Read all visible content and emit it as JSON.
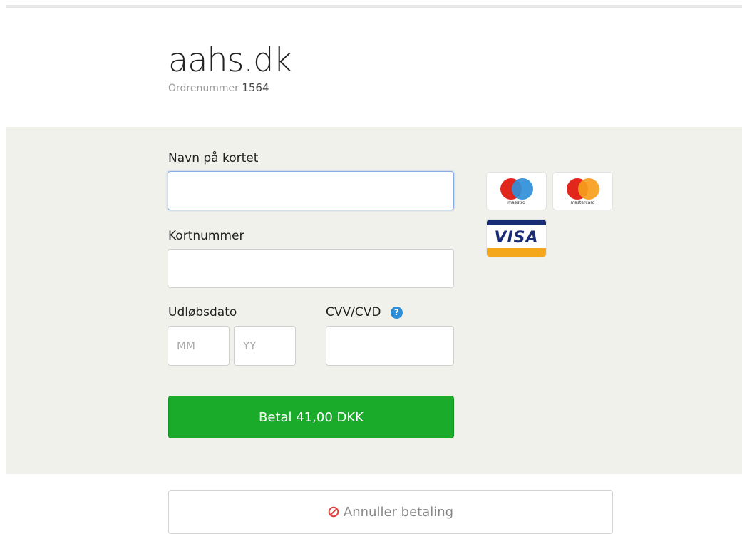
{
  "merchant": {
    "name": "aahs.dk",
    "order_label": "Ordrenummer",
    "order_number": "1564"
  },
  "form": {
    "cardholder_label": "Navn på kortet",
    "cardholder_value": "",
    "cardnumber_label": "Kortnummer",
    "cardnumber_value": "",
    "expiry_label": "Udløbsdato",
    "expiry_month_placeholder": "MM",
    "expiry_year_placeholder": "YY",
    "cvv_label": "CVV/CVD",
    "cvv_help_icon": "question-circle-icon",
    "cvv_value": "",
    "pay_button": "Betal 41,00 DKK"
  },
  "cards": {
    "maestro_label": "maestro",
    "mastercard_label": "mastercard",
    "visa_label": "VISA"
  },
  "cancel": {
    "label": "Annuller betaling",
    "icon": "cancel-circle-icon"
  },
  "colors": {
    "pay_button": "#1aab2a",
    "panel_background": "#f1f1ec",
    "help_icon": "#2d8ed8",
    "cancel_icon": "#e0413a"
  }
}
